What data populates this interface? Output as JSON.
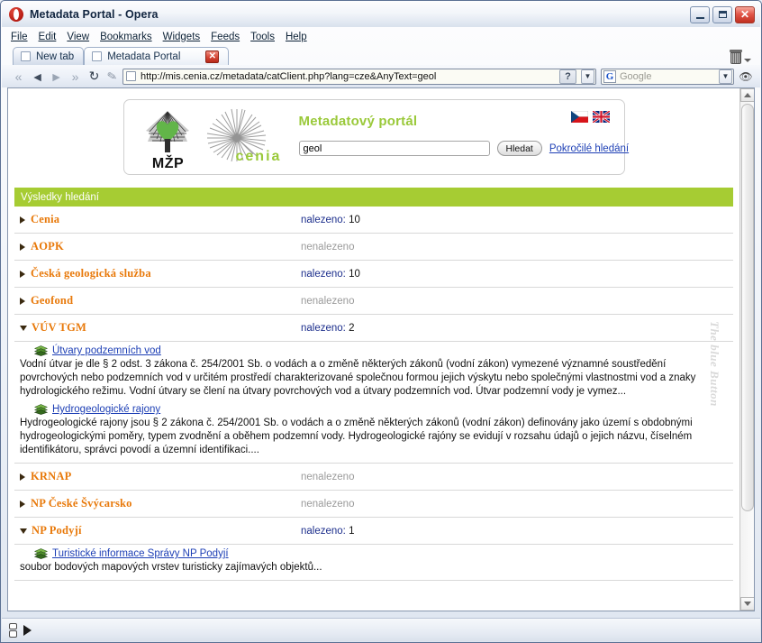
{
  "window": {
    "title": "Metadata Portal - Opera",
    "app_icon": "opera-logo",
    "minimize_label": "_",
    "maximize_label": "□",
    "close_label": "✕"
  },
  "menubar": {
    "items": [
      "File",
      "Edit",
      "View",
      "Bookmarks",
      "Widgets",
      "Feeds",
      "Tools",
      "Help"
    ]
  },
  "tabs": [
    {
      "label": "New tab",
      "active": false
    },
    {
      "label": "Metadata Portal",
      "active": true,
      "close_label": "✕"
    }
  ],
  "toolbar": {
    "back_fast_icon": "«",
    "back_icon": "◄",
    "forward_icon": "►",
    "forward_fast_icon": "»",
    "reload_icon": "↻",
    "edit_icon": "pen-icon",
    "trash_icon": "trash-icon",
    "url": "http://mis.cenia.cz/metadata/catClient.php?lang=cze&AnyText=geol",
    "url_help_label": "?",
    "url_dropdown_label": "▼",
    "search_engine": "Google",
    "search_placeholder": "Google",
    "search_dropdown_label": "▼"
  },
  "page": {
    "watermark": "The blue Button",
    "header": {
      "logo_mzp_text": "MŽP",
      "logo_cenia_text": "cenia",
      "portal_title": "Metadatový portál",
      "search_value": "geol",
      "search_button": "Hledat",
      "advanced_link": "Pokročilé hledání",
      "flags": [
        "cz-flag",
        "uk-flag"
      ]
    },
    "results_header": "Výsledky hledání",
    "labels": {
      "found": "nalezeno:",
      "not_found": "nenalezeno"
    },
    "groups": [
      {
        "name": "Cenia",
        "expanded": false,
        "found": true,
        "count": "10",
        "items": []
      },
      {
        "name": "AOPK",
        "expanded": false,
        "found": false,
        "count": "",
        "items": []
      },
      {
        "name": "Česká geologická služba",
        "expanded": false,
        "found": true,
        "count": "10",
        "items": []
      },
      {
        "name": "Geofond",
        "expanded": false,
        "found": false,
        "count": "",
        "items": []
      },
      {
        "name": "VÚV TGM",
        "expanded": true,
        "found": true,
        "count": "2",
        "items": [
          {
            "title": "Útvary podzemních vod",
            "description": "Vodní útvar je dle § 2 odst. 3 zákona č. 254/2001 Sb. o vodách a o změně některých zákonů (vodní zákon) vymezené významné soustředění povrchových nebo podzemních vod v určitém prostředí charakterizované společnou formou jejich výskytu nebo společnými vlastnostmi vod a znaky hydrologického režimu. Vodní útvary se člení na útvary povrchových vod a útvary podzemních vod. Útvar podzemní vody je vymez..."
          },
          {
            "title": "Hydrogeologické rajony",
            "description": "Hydrogeologické rajony jsou § 2 zákona č. 254/2001 Sb. o vodách a o změně některých zákonů (vodní zákon) definovány jako území s obdobnými hydrogeologickými poměry, typem zvodnění a oběhem podzemní vody. Hydrogeologické rajóny se evidují v rozsahu údajů o jejich názvu, číselném identifikátoru, správci povodí a územní identifikaci...."
          }
        ]
      },
      {
        "name": "KRNAP",
        "expanded": false,
        "found": false,
        "count": "",
        "items": []
      },
      {
        "name": "NP České Švýcarsko",
        "expanded": false,
        "found": false,
        "count": "",
        "items": []
      },
      {
        "name": "NP Podyjí",
        "expanded": true,
        "found": true,
        "count": "1",
        "items": [
          {
            "title": "Turistické informace Správy NP Podyjí",
            "description": "soubor bodových mapových vrstev turisticky zajímavých objektů..."
          }
        ]
      }
    ]
  },
  "colors": {
    "accent_green": "#a6cc33",
    "group_orange": "#e8790a",
    "link_blue": "#1d3fb5",
    "count_label": "#1c2e8c",
    "muted_gray": "#9a9a9a"
  },
  "statusbar": {
    "progress_icon": "page-icon",
    "play_icon": "play-icon"
  }
}
